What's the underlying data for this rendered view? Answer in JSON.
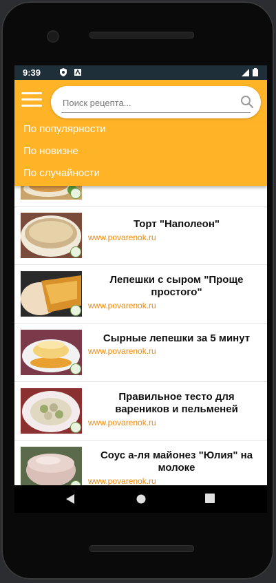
{
  "status": {
    "time": "9:39"
  },
  "search": {
    "placeholder": "Поиск рецепта..."
  },
  "sort_menu": [
    {
      "label": "По популярности"
    },
    {
      "label": "По новизне"
    },
    {
      "label": "По случайности"
    }
  ],
  "recipes": [
    {
      "title": "",
      "source": ""
    },
    {
      "title": "Торт \"Наполеон\"",
      "source": "www.povarenok.ru"
    },
    {
      "title": "Лепешки с сыром \"Проще простого\"",
      "source": "www.povarenok.ru"
    },
    {
      "title": "Сырные лепешки за 5 минут",
      "source": "www.povarenok.ru"
    },
    {
      "title": "Правильное тесто для вареников и пельменей",
      "source": "www.povarenok.ru"
    },
    {
      "title": "Соус а-ля майонез \"Юлия\" на молоке",
      "source": "www.povarenok.ru"
    }
  ],
  "colors": {
    "accent": "#ffb327",
    "source_link": "#f28a0a",
    "statusbar": "#1f2f3a"
  },
  "icons": {
    "menu": "hamburger-icon",
    "search": "search-icon",
    "back": "back-triangle-icon",
    "home": "home-circle-icon",
    "recents": "recents-square-icon"
  }
}
